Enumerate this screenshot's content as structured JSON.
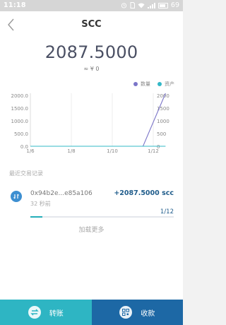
{
  "status_bar": {
    "time": "11:18",
    "battery": "69"
  },
  "header": {
    "title": "SCC"
  },
  "balance": {
    "amount": "2087.5000",
    "fiat": "≈ ¥ 0"
  },
  "legend": [
    {
      "label": "数量",
      "color": "#7b75c8"
    },
    {
      "label": "资产",
      "color": "#33b8c7"
    }
  ],
  "chart_data": {
    "type": "line",
    "x": [
      "1/6",
      "1/8",
      "1/10",
      "1/12"
    ],
    "y_left_ticks": [
      "2000.0",
      "1500.0",
      "1000.0",
      "500.0",
      "0.0"
    ],
    "y_right_ticks": [
      "2000",
      "1500",
      "1000",
      "500",
      "0"
    ],
    "ylim": [
      0,
      2087.5
    ],
    "series": [
      {
        "name": "数量",
        "color": "#7b75c8",
        "points": [
          [
            0,
            0
          ],
          [
            5.5,
            0
          ],
          [
            6.6,
            2087.5
          ]
        ]
      },
      {
        "name": "资产",
        "color": "#33b8c7",
        "points": [
          [
            0,
            0
          ],
          [
            6.6,
            0
          ]
        ]
      }
    ],
    "grid": true
  },
  "records": {
    "header": "最近交易记录",
    "items": [
      {
        "address": "0x94b2e...e85a106",
        "amount": "+2087.5000 scc",
        "time": "32 秒前",
        "progress": "1/12",
        "progress_fraction": 0.083
      }
    ],
    "load_more": "加载更多"
  },
  "actions": {
    "transfer": "转账",
    "receive": "收款"
  },
  "colors": {
    "accent": "#2eb5c3",
    "primary": "#1d68a5",
    "text_amount": "#1f5c8b"
  }
}
